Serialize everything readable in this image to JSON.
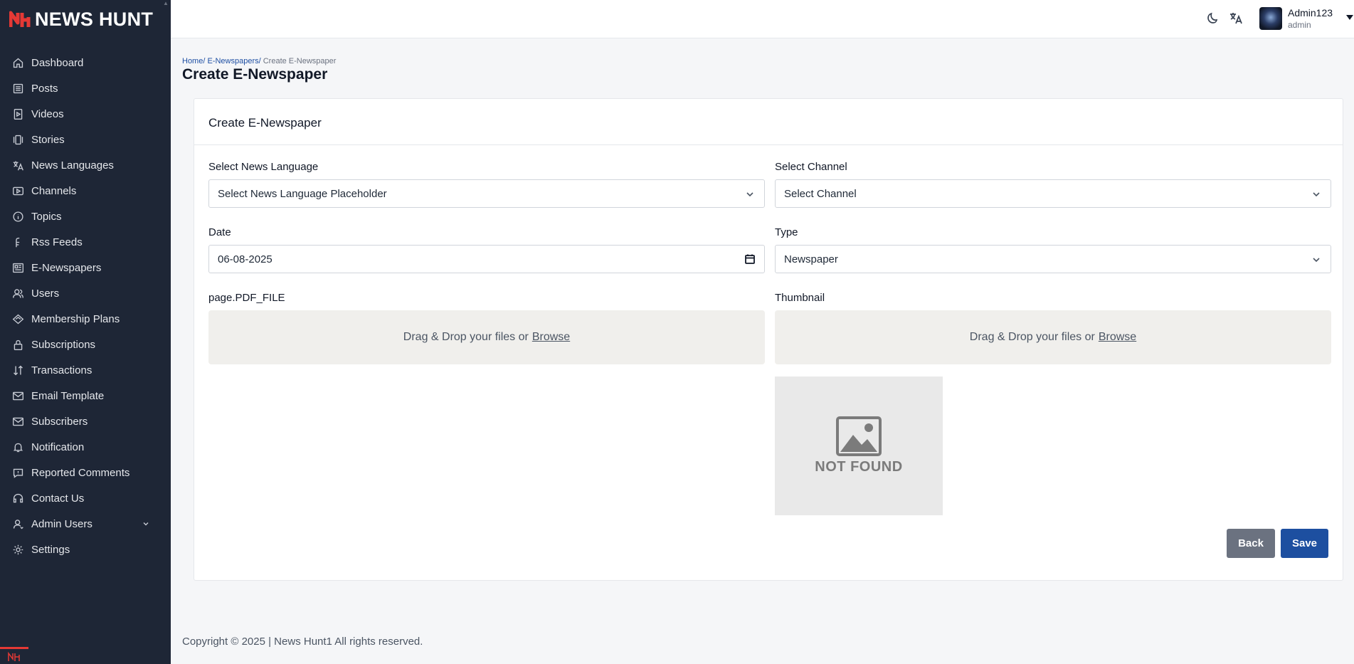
{
  "brand": {
    "name": "NEWS HUNT",
    "accent": "#e53935",
    "sidebar_bg": "#1e2636"
  },
  "sidebar": {
    "items": [
      {
        "label": "Dashboard",
        "icon": "home-icon"
      },
      {
        "label": "Posts",
        "icon": "list-icon"
      },
      {
        "label": "Videos",
        "icon": "video-icon"
      },
      {
        "label": "Stories",
        "icon": "stories-icon"
      },
      {
        "label": "News Languages",
        "icon": "translate-icon"
      },
      {
        "label": "Channels",
        "icon": "play-icon"
      },
      {
        "label": "Topics",
        "icon": "info-icon"
      },
      {
        "label": "Rss Feeds",
        "icon": "rss-icon"
      },
      {
        "label": "E-Newspapers",
        "icon": "newspaper-icon"
      },
      {
        "label": "Users",
        "icon": "users-icon"
      },
      {
        "label": "Membership Plans",
        "icon": "diamond-icon"
      },
      {
        "label": "Subscriptions",
        "icon": "lock-icon"
      },
      {
        "label": "Transactions",
        "icon": "arrows-icon"
      },
      {
        "label": "Email Template",
        "icon": "mail-icon"
      },
      {
        "label": "Subscribers",
        "icon": "mail-icon"
      },
      {
        "label": "Notification",
        "icon": "bell-icon"
      },
      {
        "label": "Reported Comments",
        "icon": "comment-icon"
      },
      {
        "label": "Contact Us",
        "icon": "headset-icon"
      },
      {
        "label": "Admin Users",
        "icon": "user-icon"
      },
      {
        "label": "Settings",
        "icon": "gear-icon"
      }
    ]
  },
  "header": {
    "user_name": "Admin123",
    "user_role": "admin"
  },
  "breadcrumb": {
    "home": "Home/",
    "section": "E-Newspapers/",
    "current": "Create E-Newspaper"
  },
  "page": {
    "title": "Create E-Newspaper"
  },
  "form": {
    "card_title": "Create E-Newspaper",
    "language_label": "Select News Language",
    "language_value": "Select News Language Placeholder",
    "channel_label": "Select Channel",
    "channel_value": "Select Channel",
    "date_label": "Date",
    "date_value": "06-08-2025",
    "type_label": "Type",
    "type_value": "Newspaper",
    "pdf_label": "page.PDF_FILE",
    "thumbnail_label": "Thumbnail",
    "dropzone_text": "Drag & Drop your files or",
    "browse_text": "Browse",
    "not_found_text": "NOT FOUND",
    "back_label": "Back",
    "save_label": "Save"
  },
  "footer": {
    "text": "Copyright © 2025 | News Hunt1 All rights reserved."
  }
}
